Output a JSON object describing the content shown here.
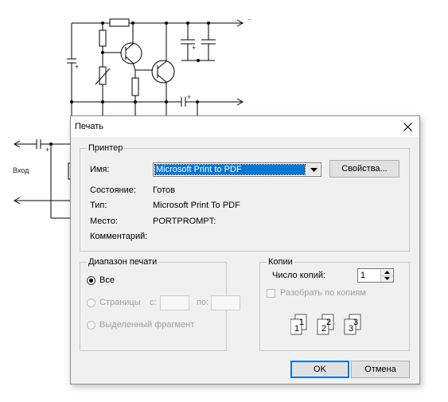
{
  "background_schematic": {
    "label_input": "Вход",
    "label_minus": "-",
    "label_plus": "+"
  },
  "dialog": {
    "title": "Печать",
    "printer_group": {
      "legend": "Принтер",
      "name_label": "Имя:",
      "name_value": "Microsoft Print to PDF",
      "properties_button": "Свойства...",
      "status_label": "Состояние:",
      "status_value": "Готов",
      "type_label": "Тип:",
      "type_value": "Microsoft Print To PDF",
      "location_label": "Место:",
      "location_value": "PORTPROMPT:",
      "comment_label": "Комментарий:",
      "comment_value": ""
    },
    "range_group": {
      "legend": "Диапазон печати",
      "all_label": "Все",
      "pages_label": "Страницы",
      "from_label": "с:",
      "from_value": "",
      "to_label": "по:",
      "to_value": "",
      "selection_label": "Выделенный фрагмент",
      "selected": "all"
    },
    "copies_group": {
      "legend": "Копии",
      "count_label": "Число копий:",
      "count_value": "1",
      "collate_label": "Разобрать по копиям",
      "collate_checked": false,
      "collate_icon_digits": [
        "1",
        "1",
        "2",
        "2",
        "3",
        "3"
      ]
    },
    "ok_button": "OK",
    "cancel_button": "Отмена"
  }
}
